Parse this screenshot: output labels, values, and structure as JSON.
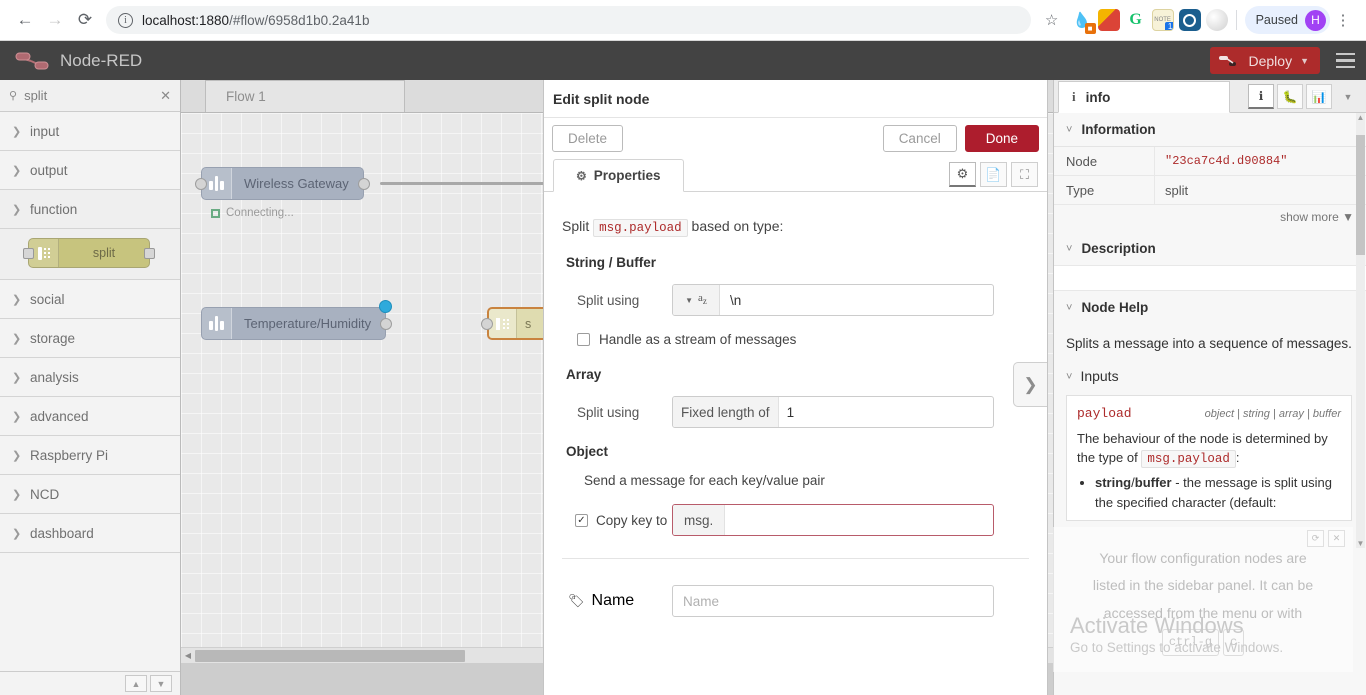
{
  "browser": {
    "url_host": "localhost:1880",
    "url_path": "/#flow/6958d1b0.2a41b",
    "back_icon": "back-arrow-icon",
    "forward_icon": "forward-arrow-icon",
    "reload_icon": "reload-icon",
    "info_icon": "site-info-icon",
    "star_icon": "bookmark-star-icon",
    "profile_label": "Paused",
    "avatar_letter": "H",
    "menu_icon": "kebab-menu-icon",
    "extensions": [
      "pipette-extension-icon",
      "ruler-extension-icon",
      "grammarly-extension-icon",
      "notes-extension-icon",
      "target-extension-icon",
      "moon-extension-icon"
    ]
  },
  "nodered": {
    "title": "Node-RED",
    "deploy_label": "Deploy",
    "menu_icon": "hamburger-menu-icon"
  },
  "palette": {
    "search_value": "split",
    "search_icon": "search-icon",
    "clear_icon": "clear-icon",
    "categories": [
      {
        "label": "input",
        "open": false
      },
      {
        "label": "output",
        "open": false
      },
      {
        "label": "function",
        "open": true
      },
      {
        "label": "social",
        "open": false
      },
      {
        "label": "storage",
        "open": false
      },
      {
        "label": "analysis",
        "open": false
      },
      {
        "label": "advanced",
        "open": false
      },
      {
        "label": "Raspberry Pi",
        "open": false
      },
      {
        "label": "NCD",
        "open": false
      },
      {
        "label": "dashboard",
        "open": false
      }
    ],
    "node_label": "split",
    "collapse_icon": "collapse-all-icon",
    "expand_icon": "expand-all-icon"
  },
  "canvas": {
    "tab_label": "Flow 1",
    "nodes": [
      {
        "label": "Wireless Gateway",
        "status": "Connecting..."
      },
      {
        "label": "Temperature/Humidity",
        "status": ""
      }
    ],
    "split_node_label": "s",
    "expand_handle_icon": "chevron-right-icon",
    "scroll_left_icon": "scroll-left-arrow-icon"
  },
  "dialog": {
    "title": "Edit split node",
    "delete_label": "Delete",
    "cancel_label": "Cancel",
    "done_label": "Done",
    "tab_label": "Properties",
    "tab_gear_icon": "gear-icon",
    "icons": [
      "gear-icon",
      "document-icon",
      "appearance-icon"
    ],
    "split_prefix": "Split",
    "split_property": "msg.payload",
    "split_suffix": "based on type:",
    "string_buffer_heading": "String / Buffer",
    "split_using_label": "Split using",
    "string_type_icon": "az-string-type-icon",
    "string_caret_icon": "chevron-down-icon",
    "string_value": "\\n",
    "stream_checkbox_label": "Handle as a stream of messages",
    "stream_checked": false,
    "array_heading": "Array",
    "array_split_label": "Split using",
    "array_prefix": "Fixed length of",
    "array_value": "1",
    "object_heading": "Object",
    "object_text": "Send a message for each key/value pair",
    "copy_key_label": "Copy key to",
    "copy_key_checked": true,
    "copy_key_prefix": "msg.",
    "copy_key_value": "",
    "name_label": "Name",
    "name_icon": "tag-icon",
    "name_placeholder": "Name"
  },
  "sidebar": {
    "tab_label": "info",
    "tab_icon": "info-icon",
    "icons": [
      "info-icon",
      "debug-bug-icon",
      "dashboard-chart-icon",
      "chevron-down-icon"
    ],
    "information_heading": "Information",
    "rows": [
      {
        "key": "Node",
        "value": "\"23ca7c4d.d90884\"",
        "mono": true
      },
      {
        "key": "Type",
        "value": "split",
        "mono": false
      }
    ],
    "show_more": "show more",
    "show_more_icon": "chevron-down-icon",
    "description_heading": "Description",
    "node_help_heading": "Node Help",
    "help_intro": "Splits a message into a sequence of messages.",
    "inputs_heading": "Inputs",
    "input_name": "payload",
    "input_types": "object | string | array | buffer",
    "input_desc_a": "The behaviour of the node is determined by the type of",
    "input_desc_code": "msg.payload",
    "input_desc_b": ":",
    "bullet_bold_a": "string",
    "bullet_sep": "/",
    "bullet_bold_b": "buffer",
    "bullet_rest": "- the message is split using the specified character (default:"
  },
  "notification": {
    "line1": "Your flow configuration nodes are",
    "line2": "listed in the sidebar panel. It can be",
    "line3": "accessed from the menu or with",
    "key1": "ctrl-g",
    "key2": "c",
    "refresh_icon": "refresh-icon",
    "close_icon": "close-icon"
  },
  "watermark": {
    "line1": "Activate Windows",
    "line2": "Go to Settings to activate Windows."
  }
}
